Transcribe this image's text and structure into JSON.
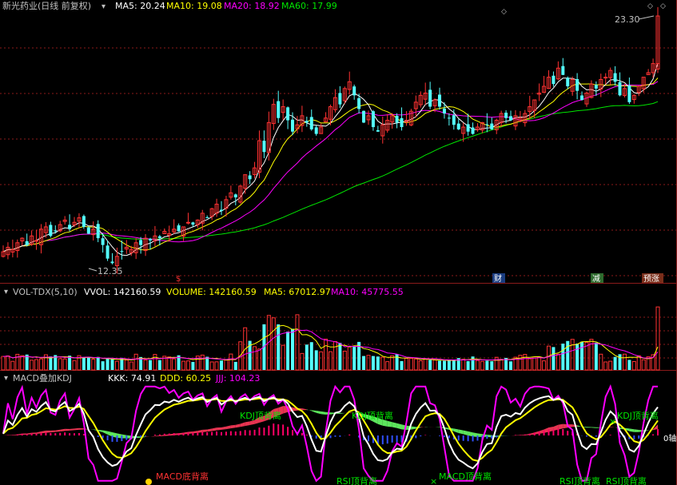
{
  "header": {
    "stock_title": "新光药业(日线 前复权)",
    "ma5": "MA5: 20.24",
    "ma10": "MA10: 19.08",
    "ma20": "MA20: 18.92",
    "ma60": "MA60: 17.99"
  },
  "price_panel": {
    "high_label": "23.30",
    "low_label": "12.35",
    "markers": [
      "$",
      "财",
      "减",
      "预涨"
    ]
  },
  "volume_panel": {
    "indicator": "VOL-TDX(5,10)",
    "vvol": "VVOL: 142160.59",
    "volume": "VOLUME: 142160.59",
    "ma5": "MA5: 67012.97",
    "ma10": "MA10: 45775.55"
  },
  "macd_panel": {
    "indicator": "MACD叠加KDJ",
    "kkk": "KKK: 74.91",
    "ddd": "DDD: 60.25",
    "jjj": "JJJ: 104.23",
    "axis_label": "0轴",
    "signals": [
      "KDJ顶背离",
      "KDJ顶背离",
      "KDJ顶背离",
      "MACD底背离",
      "RSI顶背离",
      "MACD顶背离",
      "RSI顶背离",
      "RSI顶背离"
    ]
  },
  "colors": {
    "up": "#ff3232",
    "down": "#54ffff",
    "ma5": "#ffffff",
    "ma10": "#ffff00",
    "ma20": "#ff00ff",
    "ma60": "#00e600",
    "grid": "#8b1a1a"
  },
  "chart_data": {
    "type": "candlestick",
    "ylim": [
      12.35,
      23.3
    ],
    "closes": [
      12.9,
      13.1,
      13.0,
      13.3,
      13.5,
      13.2,
      13.6,
      13.4,
      13.9,
      14.0,
      13.6,
      13.8,
      14.1,
      14.3,
      13.9,
      14.2,
      14.4,
      14.0,
      13.7,
      13.9,
      13.5,
      13.2,
      12.6,
      12.4,
      12.7,
      12.9,
      13.1,
      13.0,
      13.3,
      13.2,
      13.5,
      13.4,
      13.6,
      13.5,
      13.8,
      13.7,
      13.9,
      13.8,
      14.0,
      14.2,
      14.1,
      14.3,
      14.6,
      14.4,
      14.8,
      15.0,
      14.7,
      15.2,
      15.5,
      15.3,
      15.8,
      16.3,
      16.1,
      16.6,
      17.8,
      17.3,
      18.6,
      19.4,
      18.8,
      19.3,
      18.7,
      18.2,
      18.5,
      18.9,
      18.6,
      18.3,
      18.1,
      18.4,
      18.8,
      19.3,
      19.7,
      19.4,
      20.1,
      20.4,
      19.8,
      19.2,
      18.6,
      18.9,
      18.4,
      18.2,
      18.5,
      18.7,
      18.9,
      18.6,
      18.4,
      18.7,
      19.1,
      19.5,
      19.8,
      19.9,
      19.3,
      19.6,
      19.3,
      19.0,
      18.8,
      18.5,
      18.3,
      18.4,
      18.2,
      18.1,
      18.4,
      18.6,
      18.5,
      18.3,
      18.7,
      19.0,
      18.8,
      18.7,
      18.9,
      18.8,
      19.0,
      19.3,
      19.6,
      19.9,
      20.2,
      20.6,
      20.3,
      21.0,
      20.7,
      20.2,
      20.5,
      20.0,
      19.6,
      19.9,
      20.3,
      20.1,
      20.5,
      20.6,
      20.9,
      20.4,
      19.8,
      20.1,
      19.5,
      19.8,
      20.2,
      20.6,
      20.8,
      21.2,
      23.3
    ],
    "vol_ylim": [
      0,
      100
    ]
  }
}
